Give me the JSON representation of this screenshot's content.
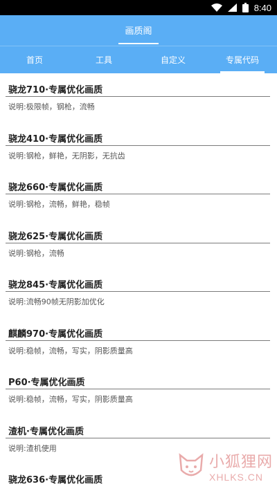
{
  "status_bar": {
    "time": "8:40",
    "icons": [
      "wifi-icon",
      "signal-icon",
      "battery-icon"
    ]
  },
  "header": {
    "title": "画质阁"
  },
  "tabs": [
    {
      "label": "首页",
      "active": false
    },
    {
      "label": "工具",
      "active": false
    },
    {
      "label": "自定义",
      "active": false
    },
    {
      "label": "专属代码",
      "active": true
    }
  ],
  "items": [
    {
      "title": "骁龙710·专属优化画质",
      "desc": "说明:极限帧，钢枪，流畅"
    },
    {
      "title": "骁龙410·专属优化画质",
      "desc": "说明:钢枪，鲜艳，无阴影，无抗齿"
    },
    {
      "title": "骁龙660·专属优化画质",
      "desc": "说明:钢枪，流畅，鲜艳，稳帧"
    },
    {
      "title": "骁龙625·专属优化画质",
      "desc": "说明:钢枪，流畅"
    },
    {
      "title": "骁龙845·专属优化画质",
      "desc": "说明:流畅90帧无阴影加优化"
    },
    {
      "title": "麒麟970·专属优化画质",
      "desc": "说明:稳帧，流畅，写实，阴影质量高"
    },
    {
      "title": "P60·专属优化画质",
      "desc": "说明:稳帧，流畅，写实，阴影质量高"
    },
    {
      "title": "渣机·专属优化画质",
      "desc": "说明:渣机使用"
    },
    {
      "title": "骁龙636·专属优化画质",
      "desc": ""
    }
  ],
  "watermark": {
    "cn": "小狐狸网",
    "en": "XHLKS.CN"
  },
  "colors": {
    "accent": "#5aaef5",
    "watermark": "#e7a3a3"
  }
}
